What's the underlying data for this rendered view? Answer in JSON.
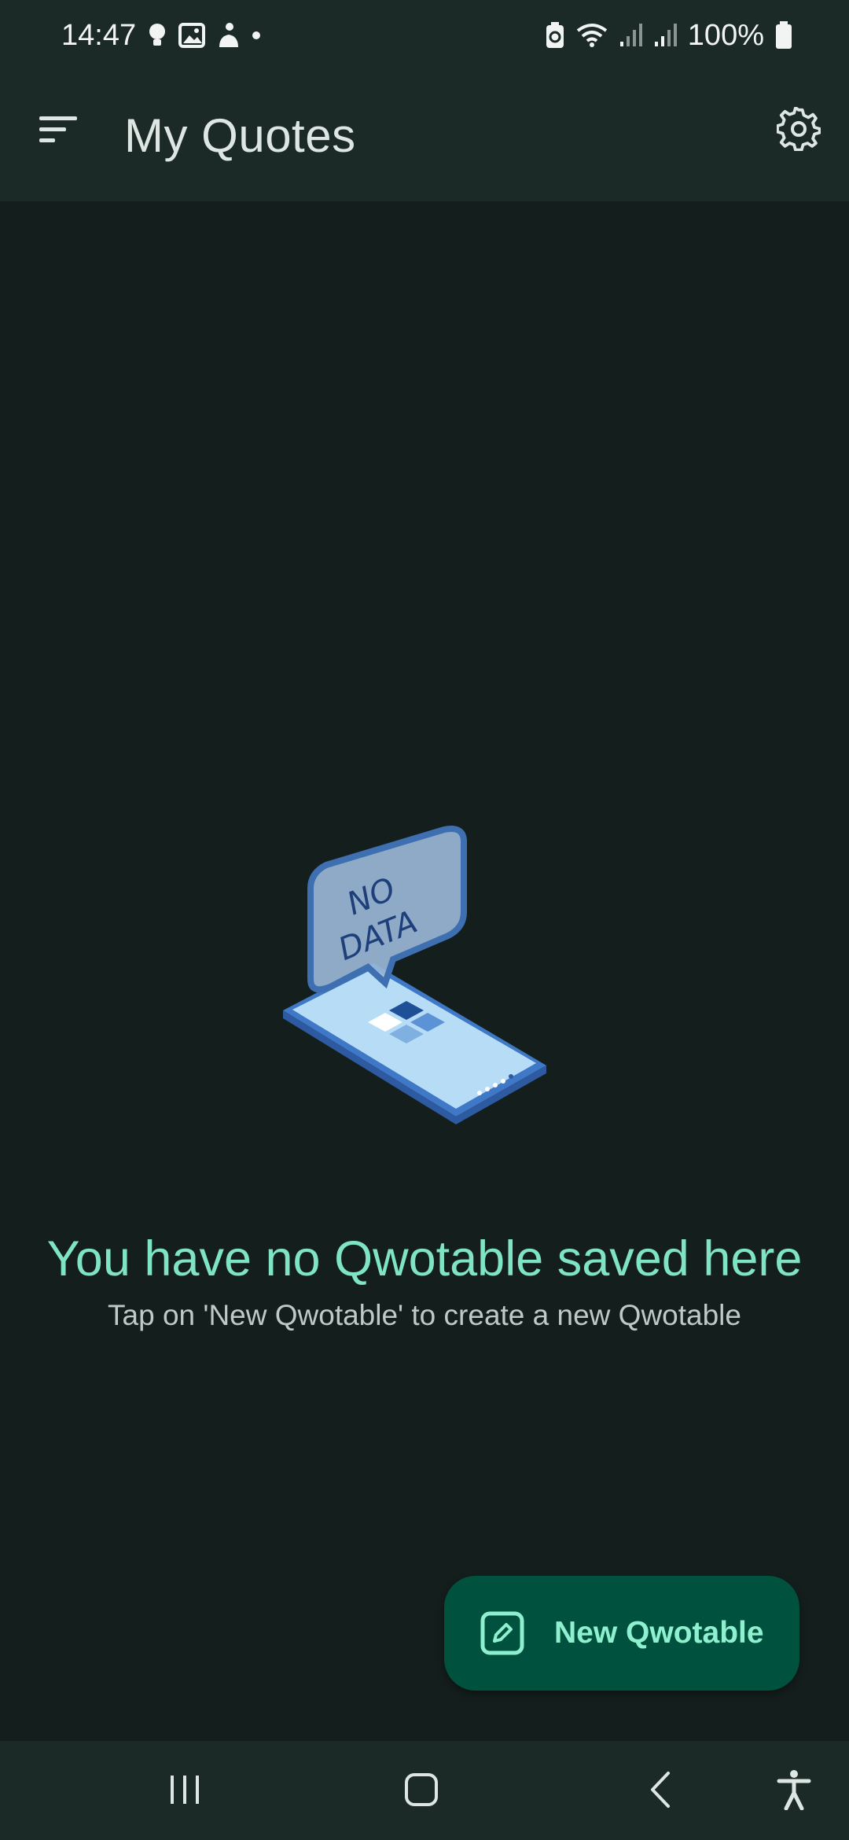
{
  "status_bar": {
    "time": "14:47",
    "battery_percent": "100%",
    "left_icons": [
      "lightbulb-icon",
      "image-icon",
      "person-icon",
      "dot-icon"
    ],
    "right_icons": [
      "battery-saver-icon",
      "wifi-icon",
      "signal-icon",
      "signal-icon",
      "battery-icon"
    ]
  },
  "app_bar": {
    "title": "My Quotes",
    "menu_icon": "sort-menu-icon",
    "settings_icon": "gear-icon"
  },
  "empty_state": {
    "illustration_text_line1": "NO",
    "illustration_text_line2": "DATA",
    "title": "You have no Qwotable saved here",
    "subtitle": "Tap on 'New Qwotable' to create a new Qwotable"
  },
  "fab": {
    "label": "New Qwotable",
    "icon": "edit-square-icon"
  },
  "nav_bar": {
    "items": [
      "recent-apps-icon",
      "home-icon",
      "back-icon",
      "accessibility-icon"
    ]
  },
  "colors": {
    "background": "#141e1c",
    "bar": "#1c2a27",
    "accent": "#7fe4c3",
    "fab_background": "#00513d",
    "fab_text": "#8ff0cf"
  }
}
